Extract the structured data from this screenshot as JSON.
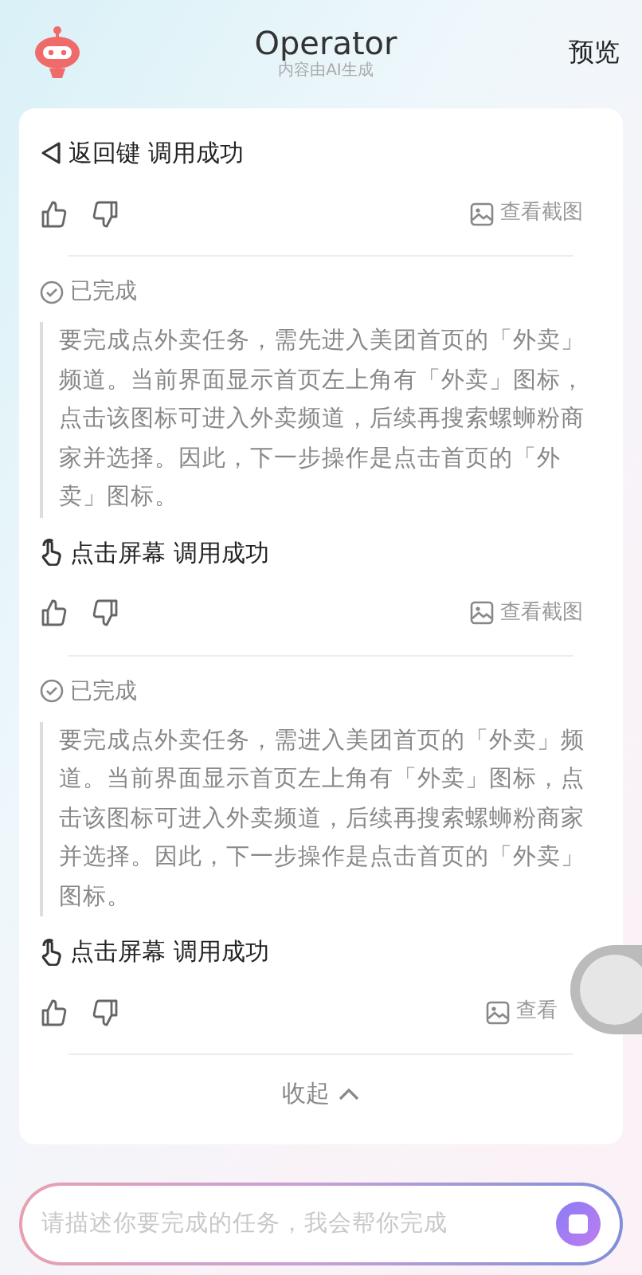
{
  "header": {
    "title": "Operator",
    "subtitle": "内容由AI生成",
    "action": "预览"
  },
  "steps": [
    {
      "kind": "back",
      "action": "返回键 调用成功",
      "screenshot_link": "查看截图"
    },
    {
      "status": "已完成",
      "reasoning": "要完成点外卖任务，需先进入美团首页的「外卖」频道。当前界面显示首页左上角有「外卖」图标，点击该图标可进入外卖频道，后续再搜索螺蛳粉商家并选择。因此，下一步操作是点击首页的「外卖」图标。",
      "kind": "tap",
      "action": "点击屏幕 调用成功",
      "screenshot_link": "查看截图"
    },
    {
      "status": "已完成",
      "reasoning": "要完成点外卖任务，需进入美团首页的「外卖」频道。当前界面显示首页左上角有「外卖」图标，点击该图标可进入外卖频道，后续再搜索螺蛳粉商家并选择。因此，下一步操作是点击首页的「外卖」图标。",
      "kind": "tap",
      "action": "点击屏幕 调用成功",
      "screenshot_link": "查看"
    }
  ],
  "collapse": "收起",
  "input": {
    "placeholder": "请描述你要完成的任务，我会帮你完成"
  }
}
